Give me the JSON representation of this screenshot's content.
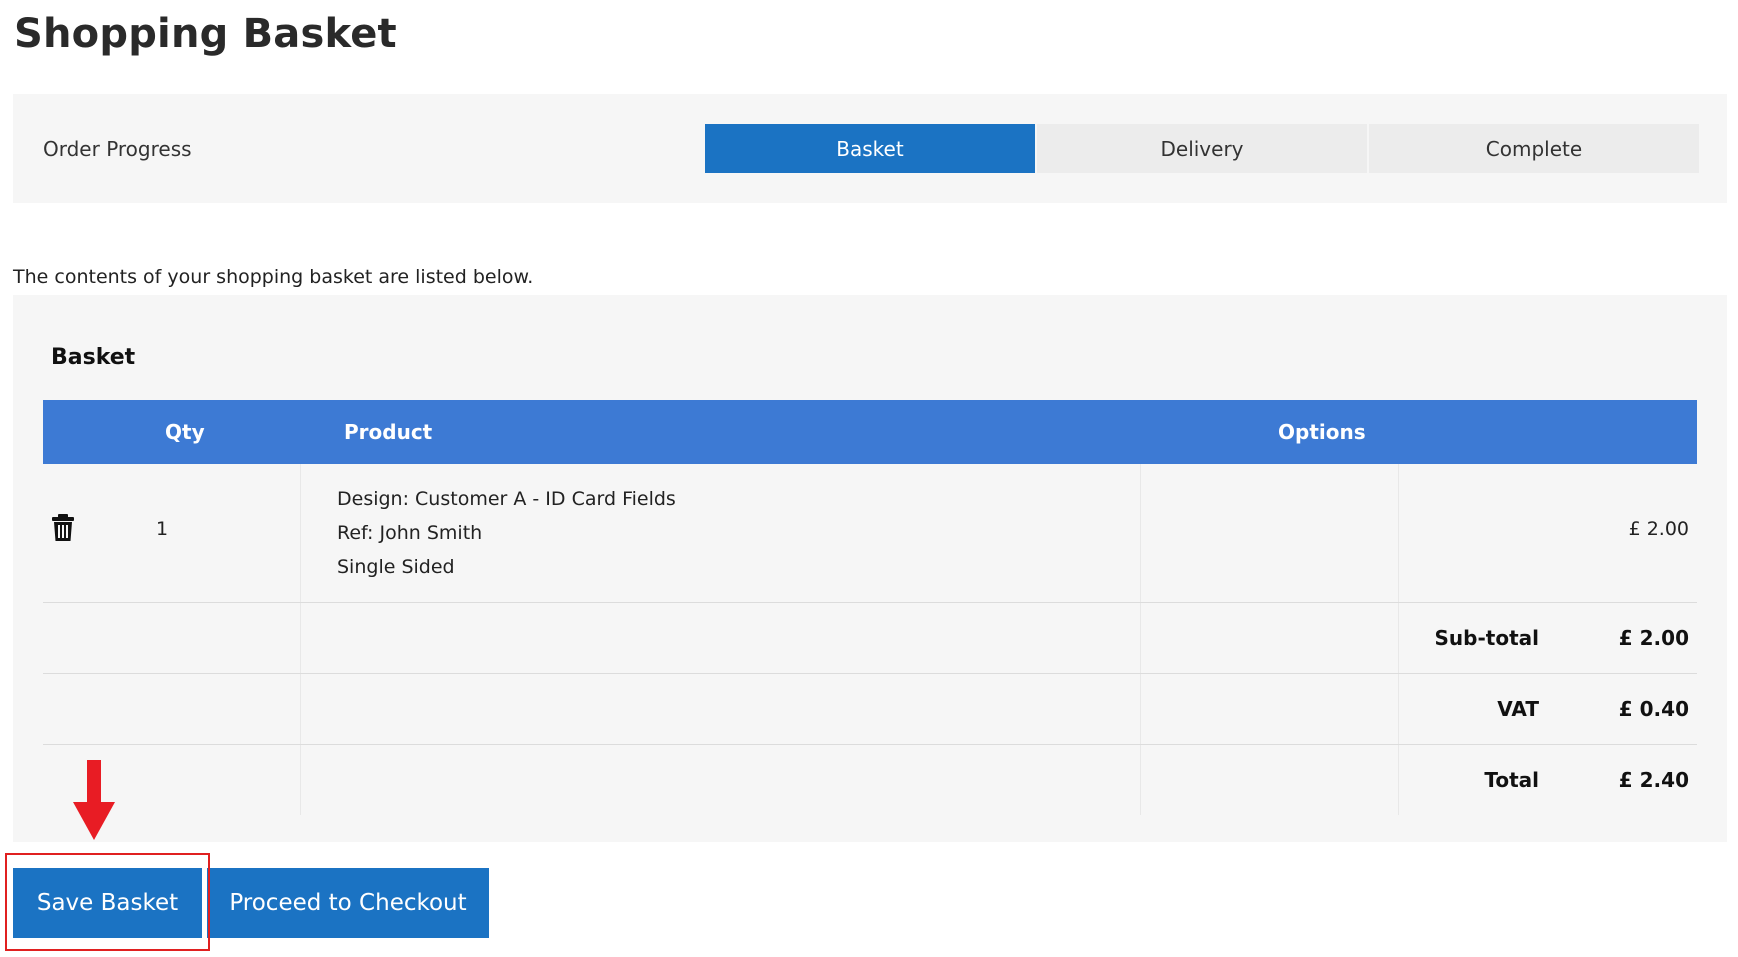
{
  "page": {
    "title": "Shopping Basket",
    "intro": "The contents of your shopping basket are listed below."
  },
  "progress": {
    "label": "Order Progress",
    "steps": [
      {
        "label": "Basket",
        "active": true
      },
      {
        "label": "Delivery",
        "active": false
      },
      {
        "label": "Complete",
        "active": false
      }
    ]
  },
  "basket": {
    "heading": "Basket",
    "columns": {
      "qty": "Qty",
      "product": "Product",
      "options": "Options"
    },
    "items": [
      {
        "qty": "1",
        "product_lines": [
          "Design: Customer A - ID Card Fields",
          "Ref: John Smith",
          "Single Sided"
        ],
        "price": "£ 2.00"
      }
    ],
    "summary": [
      {
        "label": "Sub-total",
        "value": "£ 2.00"
      },
      {
        "label": "VAT",
        "value": "£ 0.40"
      },
      {
        "label": "Total",
        "value": "£ 2.40"
      }
    ]
  },
  "actions": {
    "save_label": "Save Basket",
    "checkout_label": "Proceed to Checkout"
  },
  "colors": {
    "primary": "#1b73c3",
    "table_header": "#3d7ad4",
    "panel_bg": "#f6f6f6",
    "annotation": "#e02020"
  },
  "icons": {
    "delete": "trash-icon",
    "annotation": "arrow-down-icon"
  }
}
